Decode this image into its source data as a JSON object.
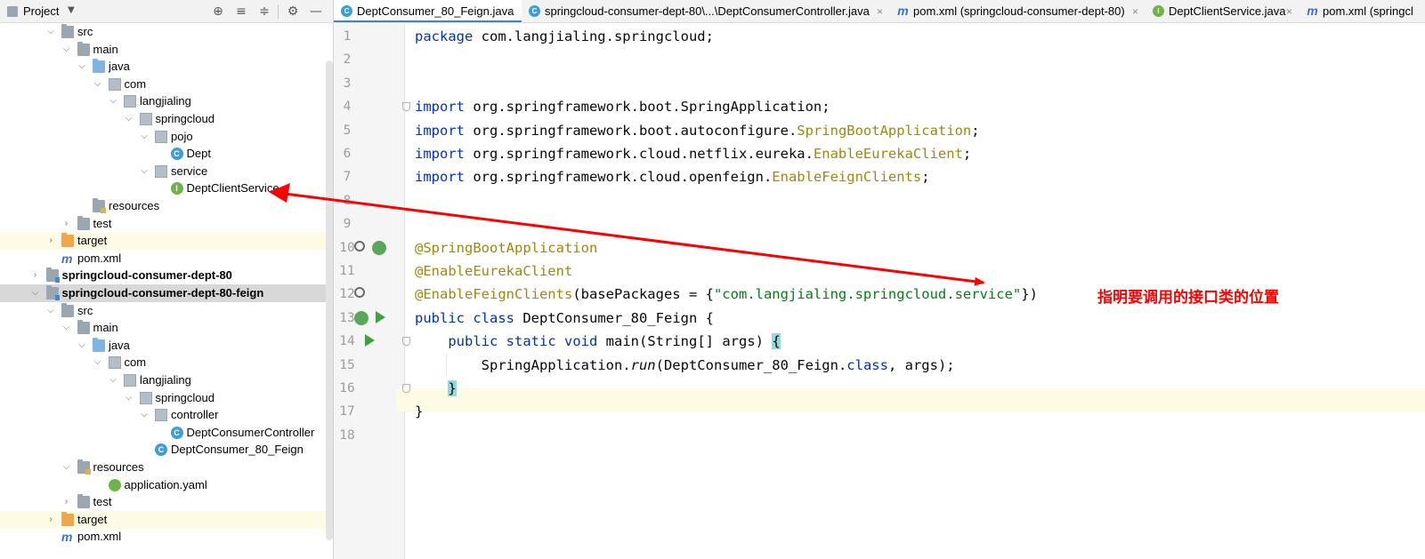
{
  "project_panel": {
    "title": "Project",
    "tree": [
      {
        "label": "src",
        "depth": 2,
        "icon": "folder-icon",
        "expanded": true
      },
      {
        "label": "main",
        "depth": 3,
        "icon": "folder-icon",
        "expanded": true
      },
      {
        "label": "java",
        "depth": 4,
        "icon": "source-folder-icon",
        "expanded": true
      },
      {
        "label": "com",
        "depth": 5,
        "icon": "package-icon",
        "expanded": true
      },
      {
        "label": "langjialing",
        "depth": 6,
        "icon": "package-icon",
        "expanded": true
      },
      {
        "label": "springcloud",
        "depth": 7,
        "icon": "package-icon",
        "expanded": true
      },
      {
        "label": "pojo",
        "depth": 8,
        "icon": "package-icon",
        "expanded": true
      },
      {
        "label": "Dept",
        "depth": 9,
        "icon": "class-icon",
        "leaf": true
      },
      {
        "label": "service",
        "depth": 8,
        "icon": "package-icon",
        "expanded": true
      },
      {
        "label": "DeptClientService",
        "depth": 9,
        "icon": "interface-icon",
        "leaf": true
      },
      {
        "label": "resources",
        "depth": 4,
        "icon": "resources-folder-icon",
        "leaf": true
      },
      {
        "label": "test",
        "depth": 3,
        "icon": "folder-icon",
        "expanded": false
      },
      {
        "label": "target",
        "depth": 2,
        "icon": "target-folder-icon",
        "expanded": false,
        "highlight": "yellow"
      },
      {
        "label": "pom.xml",
        "depth": 2,
        "icon": "maven-icon",
        "leaf": true
      },
      {
        "label": "springcloud-consumer-dept-80",
        "depth": 1,
        "icon": "module-icon",
        "expanded": false,
        "bold": true
      },
      {
        "label": "springcloud-consumer-dept-80-feign",
        "depth": 1,
        "icon": "module-icon",
        "expanded": true,
        "bold": true,
        "highlight": "grey"
      },
      {
        "label": "src",
        "depth": 2,
        "icon": "folder-icon",
        "expanded": true
      },
      {
        "label": "main",
        "depth": 3,
        "icon": "folder-icon",
        "expanded": true
      },
      {
        "label": "java",
        "depth": 4,
        "icon": "source-folder-icon",
        "expanded": true
      },
      {
        "label": "com",
        "depth": 5,
        "icon": "package-icon",
        "expanded": true
      },
      {
        "label": "langjialing",
        "depth": 6,
        "icon": "package-icon",
        "expanded": true
      },
      {
        "label": "springcloud",
        "depth": 7,
        "icon": "package-icon",
        "expanded": true
      },
      {
        "label": "controller",
        "depth": 8,
        "icon": "package-icon",
        "expanded": true
      },
      {
        "label": "DeptConsumerController",
        "depth": 9,
        "icon": "class-icon",
        "leaf": true
      },
      {
        "label": "DeptConsumer_80_Feign",
        "depth": 8,
        "icon": "class-icon",
        "leaf": true
      },
      {
        "label": "resources",
        "depth": 3,
        "icon": "resources-folder-icon",
        "expanded": true
      },
      {
        "label": "application.yaml",
        "depth": 5,
        "icon": "yaml-icon",
        "leaf": true
      },
      {
        "label": "test",
        "depth": 3,
        "icon": "folder-icon",
        "expanded": false
      },
      {
        "label": "target",
        "depth": 2,
        "icon": "target-folder-icon",
        "expanded": false,
        "highlight": "yellow"
      },
      {
        "label": "pom.xml",
        "depth": 2,
        "icon": "maven-icon",
        "leaf": true
      }
    ]
  },
  "tabs": [
    {
      "label": "DeptConsumer_80_Feign.java",
      "icon": "class-icon",
      "active": true,
      "closable": true
    },
    {
      "label": "springcloud-consumer-dept-80\\...\\DeptConsumerController.java",
      "icon": "class-icon",
      "active": false,
      "closable": true
    },
    {
      "label": "pom.xml (springcloud-consumer-dept-80)",
      "icon": "maven-icon",
      "active": false,
      "closable": true
    },
    {
      "label": "DeptClientService.java",
      "icon": "interface-icon",
      "active": false,
      "closable": true
    },
    {
      "label": "pom.xml (springcl",
      "icon": "maven-icon",
      "active": false,
      "closable": false
    }
  ],
  "close_glyph": "×",
  "code_lines": [
    [
      {
        "t": "package",
        "c": "kw"
      },
      {
        "t": " com.langjialing.springcloud;"
      }
    ],
    [],
    [],
    [
      {
        "t": "import",
        "c": "kw"
      },
      {
        "t": " org.springframework.boot.SpringApplication;"
      }
    ],
    [
      {
        "t": "import",
        "c": "kw"
      },
      {
        "t": " org.springframework.boot.autoconfigure."
      },
      {
        "t": "SpringBootApplication",
        "c": "ann"
      },
      {
        "t": ";"
      }
    ],
    [
      {
        "t": "import",
        "c": "kw"
      },
      {
        "t": " org.springframework.cloud.netflix.eureka."
      },
      {
        "t": "EnableEurekaClient",
        "c": "ann"
      },
      {
        "t": ";"
      }
    ],
    [
      {
        "t": "import",
        "c": "kw"
      },
      {
        "t": " org.springframework.cloud.openfeign."
      },
      {
        "t": "EnableFeignClients",
        "c": "ann"
      },
      {
        "t": ";"
      }
    ],
    [],
    [],
    [
      {
        "t": "@SpringBootApplication",
        "c": "ann"
      }
    ],
    [
      {
        "t": "@EnableEurekaClient",
        "c": "ann"
      }
    ],
    [
      {
        "t": "@EnableFeignClients",
        "c": "ann"
      },
      {
        "t": "(basePackages = {"
      },
      {
        "t": "\"com.langjialing.springcloud.service\"",
        "c": "str"
      },
      {
        "t": "})"
      }
    ],
    [
      {
        "t": "public",
        "c": "kw"
      },
      {
        "t": " "
      },
      {
        "t": "class",
        "c": "kw"
      },
      {
        "t": " DeptConsumer_80_Feign {"
      }
    ],
    [
      {
        "t": "    "
      },
      {
        "t": "public",
        "c": "kw"
      },
      {
        "t": " "
      },
      {
        "t": "static",
        "c": "kw"
      },
      {
        "t": " "
      },
      {
        "t": "void",
        "c": "kw"
      },
      {
        "t": " main(String[] args) "
      },
      {
        "t": "{",
        "c": "brace-hl"
      }
    ],
    [
      {
        "t": "        SpringApplication."
      },
      {
        "t": "run",
        "c": "it"
      },
      {
        "t": "(DeptConsumer_80_Feign."
      },
      {
        "t": "class",
        "c": "kw"
      },
      {
        "t": ", args);"
      }
    ],
    [
      {
        "t": "    "
      },
      {
        "t": "}",
        "c": "brace-hl"
      }
    ],
    [
      {
        "t": "}"
      }
    ],
    []
  ],
  "line_numbers": [
    "1",
    "2",
    "3",
    "4",
    "5",
    "6",
    "7",
    "8",
    "9",
    "10",
    "11",
    "12",
    "13",
    "14",
    "15",
    "16",
    "17",
    "18"
  ],
  "annotation": {
    "note": "指明要调用的接口类的位置",
    "color": "#ff0000"
  },
  "colors": {
    "keyword": "#0033b3",
    "annotation": "#9e880d",
    "string": "#067d17",
    "current_line": "#fdfbe3",
    "tab_underline": "#4083c9"
  }
}
